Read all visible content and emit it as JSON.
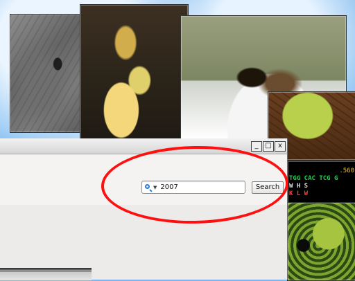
{
  "search": {
    "value": "2007",
    "button_label": "Search"
  },
  "window": {
    "controls": [
      "_",
      "□",
      "x"
    ]
  },
  "photos": {
    "dna": {
      "top_number": ".560",
      "sequence": "TGG CAC TCG G",
      "amino": " W   H   S",
      "amino2": " K   L   W"
    }
  },
  "colors": {
    "desktop_blue": "#7fb7ea",
    "annotation_red": "#ff1010",
    "search_icon_blue": "#2b7bd6"
  }
}
